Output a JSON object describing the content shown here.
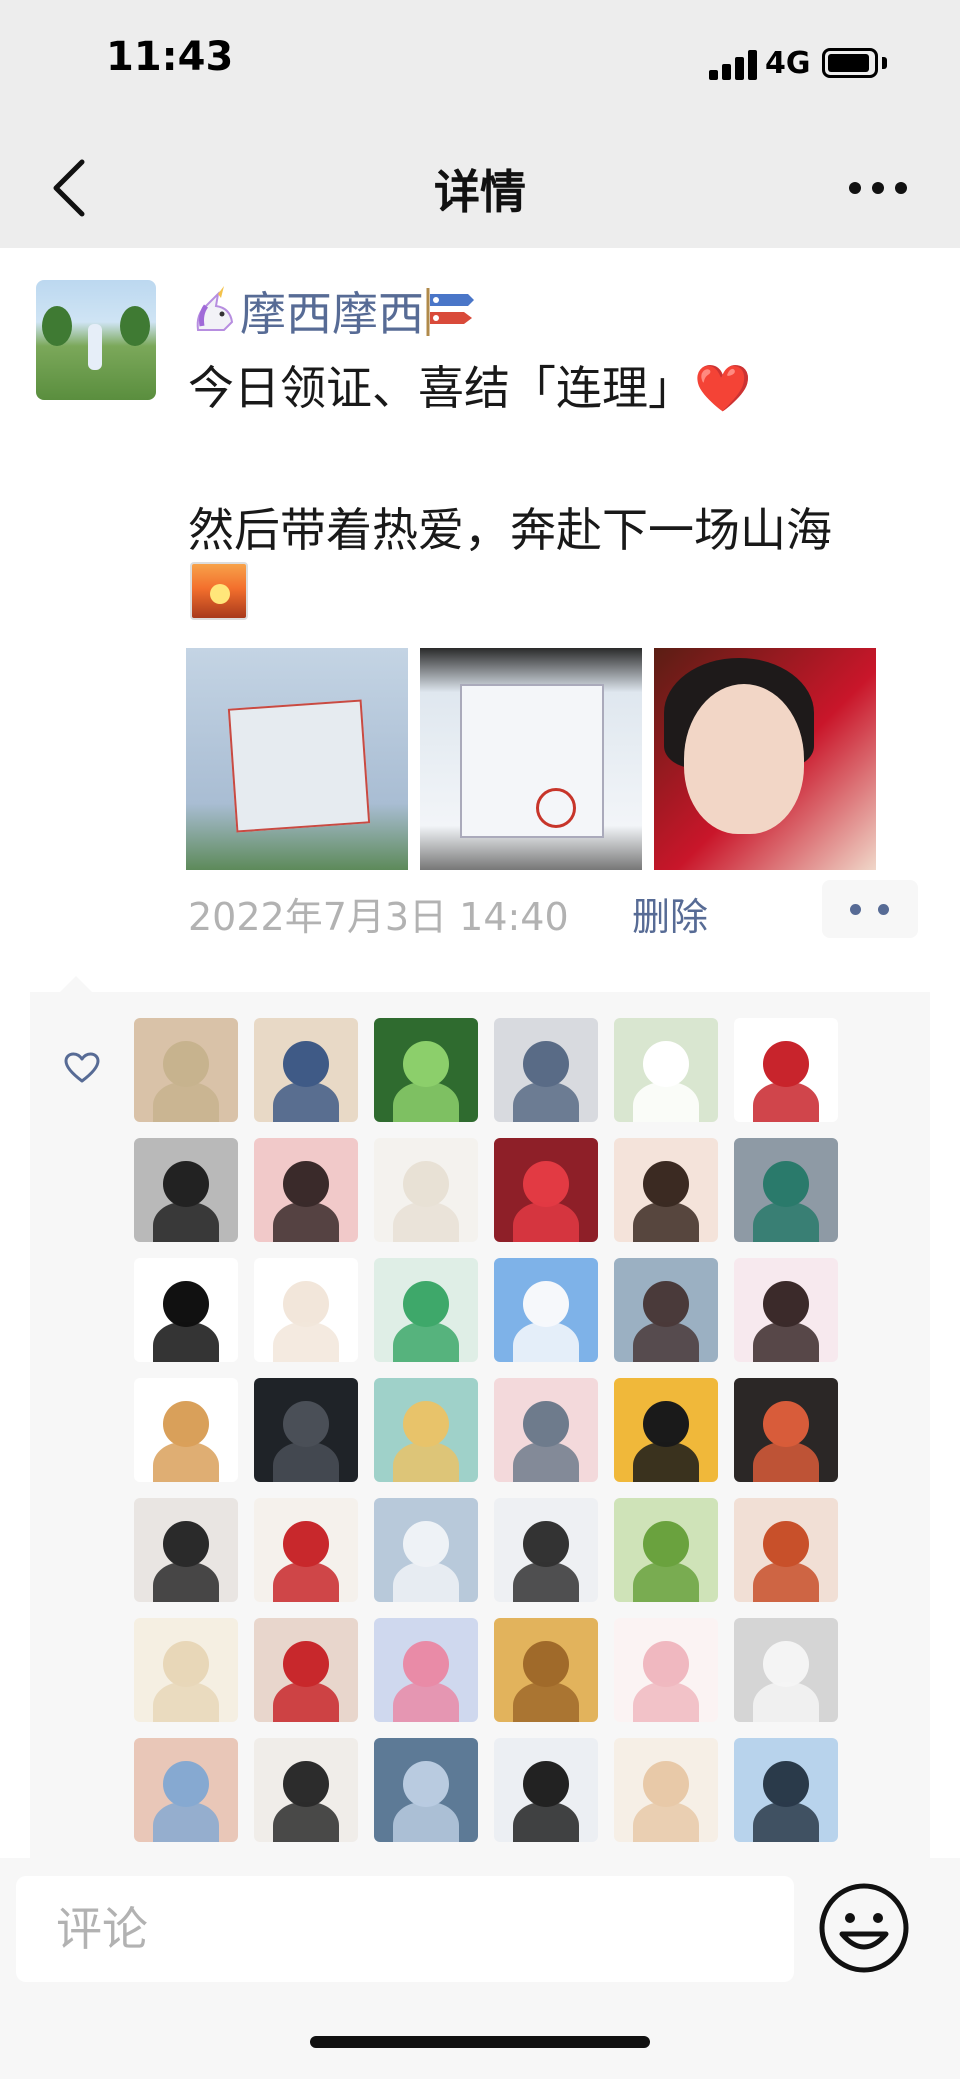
{
  "status_bar": {
    "time": "11:43",
    "network": "4G"
  },
  "nav": {
    "title": "详情",
    "back_icon": "chevron-left-icon",
    "more_icon": "more-dots-icon"
  },
  "post": {
    "username": "摩西摩西",
    "username_prefix_emoji": "unicorn-icon",
    "username_suffix_emoji": "carp-streamer-icon",
    "line1": "今日领证、喜结「连理」❤️",
    "line2": "然后带着热爱，奔赴下一场山海",
    "trailing_emoji": "sunrise-icon",
    "photos": [
      "photo-certificate",
      "photo-certificate-seal",
      "photo-portrait"
    ],
    "timestamp": "2022年7月3日 14:40",
    "delete_label": "删除"
  },
  "likes": {
    "icon": "heart-outline-icon",
    "avatar_colors": [
      [
        "#d9c2a8",
        "#c7b38e"
      ],
      [
        "#e8d9c6",
        "#3f5a86"
      ],
      [
        "#2f6b2f",
        "#8ccf6b"
      ],
      [
        "#d8dadf",
        "#596b86"
      ],
      [
        "#d9e6d0",
        "#ffffff"
      ],
      [
        "#ffffff",
        "#c8242c"
      ],
      [
        "#b9b9b9",
        "#222222"
      ],
      [
        "#f1c9c9",
        "#3a2a2a"
      ],
      [
        "#f4f2ee",
        "#e8e1d5"
      ],
      [
        "#8e1f28",
        "#e23a43"
      ],
      [
        "#f4e3da",
        "#3b2a22"
      ],
      [
        "#8e9aa5",
        "#2a7a6b"
      ],
      [
        "#ffffff",
        "#111111"
      ],
      [
        "#ffffff",
        "#f2e6da"
      ],
      [
        "#dfeee6",
        "#3ea86a"
      ],
      [
        "#7eb2e8",
        "#f6f8fb"
      ],
      [
        "#9bb0c2",
        "#4a3a3a"
      ],
      [
        "#f7e9ee",
        "#3b2a2a"
      ],
      [
        "#ffffff",
        "#d9a05a"
      ],
      [
        "#1f2328",
        "#4a4f57"
      ],
      [
        "#9fd1c9",
        "#e8c36a"
      ],
      [
        "#f3d9db",
        "#6e7b8c"
      ],
      [
        "#f0b83a",
        "#1a1a1a"
      ],
      [
        "#2b2726",
        "#d85c3a"
      ],
      [
        "#e9e5e2",
        "#2a2a2a"
      ],
      [
        "#f5f1ec",
        "#c8282c"
      ],
      [
        "#b8c9da",
        "#eef2f6"
      ],
      [
        "#eef0f3",
        "#333333"
      ],
      [
        "#cfe3b8",
        "#6aa23e"
      ],
      [
        "#f1dfd5",
        "#c8502a"
      ],
      [
        "#f5efe2",
        "#e8d7b8"
      ],
      [
        "#e8d6cc",
        "#c8282c"
      ],
      [
        "#cfd8ee",
        "#e98ba7"
      ],
      [
        "#e2b35c",
        "#a06a2a"
      ],
      [
        "#fbf3f3",
        "#f0b8c0"
      ],
      [
        "#d5d5d5",
        "#f4f4f4"
      ],
      [
        "#e9c7b8",
        "#86a9d1"
      ],
      [
        "#f0ede9",
        "#2c2c2c"
      ],
      [
        "#5d7a96",
        "#b9cbe0"
      ],
      [
        "#eceff3",
        "#222222"
      ],
      [
        "#f6efe6",
        "#e8c9a8"
      ],
      [
        "#b8d3ec",
        "#2a3a4a"
      ]
    ]
  },
  "comment": {
    "placeholder": "评论",
    "emoji_icon": "smiley-face-icon"
  }
}
